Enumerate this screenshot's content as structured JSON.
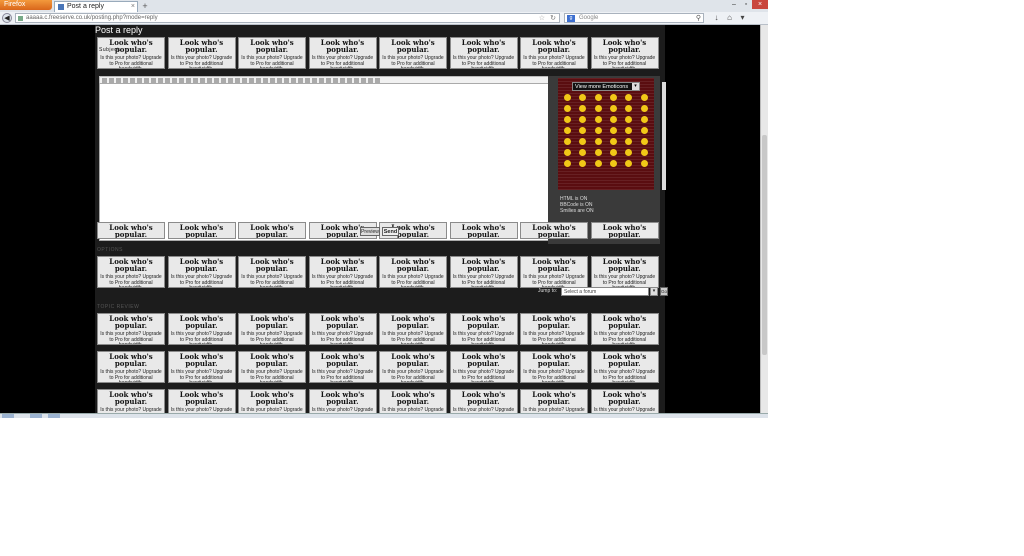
{
  "browser": {
    "menu_button": "Firefox",
    "tab_title": "Post a reply",
    "tab_close": "×",
    "new_tab": "+",
    "url": "aaaaa.c.freeserve.co.uk/posting.php?mode=reply",
    "search_placeholder": "Google",
    "search_engine_glyph": "g",
    "controls": [
      "–",
      "▫",
      "×"
    ],
    "nav_icons": [
      "↓",
      "⌂",
      "▾"
    ]
  },
  "page": {
    "heading": "Post a reply",
    "section_options_label": "OPTIONS",
    "section_topic_review_label": "TOPIC REVIEW",
    "subject_label": "Subject:",
    "badge_heading": "Look who's popular.",
    "badge_text": "Is this your photo? Upgrade to Pro for additional bandwidth.",
    "emoticons_label": "View more Emoticons",
    "emoticons_arrow": "▾",
    "status_lines": [
      "HTML is ON",
      "BBCode is ON",
      "Smilies are ON"
    ],
    "preview_label": "Preview",
    "send_label": "Send",
    "jump_label": "Jump to:",
    "jump_select": "Select a forum",
    "jump_go": "Go",
    "smiley_count": 42
  },
  "colors": {
    "page_bg": "#000000",
    "content_bg": "#1c1c1c",
    "badge_bg": "#e9e9e9",
    "smiley_bg": "#5a0d10",
    "smiley": "#f1c817"
  }
}
